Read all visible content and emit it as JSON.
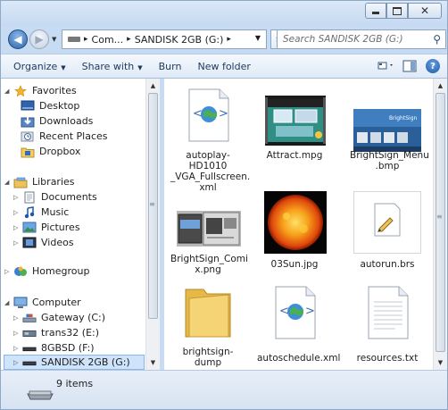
{
  "window": {
    "caption_buttons": [
      "minimize",
      "maximize",
      "close"
    ]
  },
  "address_bar": {
    "segments": [
      "Com...",
      "SANDISK 2GB (G:)"
    ],
    "separator": "▸",
    "search_placeholder": "Search SANDISK 2GB (G:)"
  },
  "toolbar": {
    "organize": "Organize",
    "share_with": "Share with",
    "burn": "Burn",
    "new_folder": "New folder",
    "view_icon": "view-options-icon",
    "preview_icon": "preview-pane-icon",
    "help_icon": "help-icon",
    "help_glyph": "?"
  },
  "nav_pane": {
    "favorites": {
      "label": "Favorites",
      "items": [
        "Desktop",
        "Downloads",
        "Recent Places",
        "Dropbox"
      ]
    },
    "libraries": {
      "label": "Libraries",
      "items": [
        "Documents",
        "Music",
        "Pictures",
        "Videos"
      ]
    },
    "homegroup": {
      "label": "Homegroup"
    },
    "computer": {
      "label": "Computer",
      "items": [
        "Gateway (C:)",
        "trans32 (E:)",
        "8GBSD (F:)",
        "SANDISK 2GB (G:)"
      ],
      "selected": "SANDISK 2GB (G:)"
    }
  },
  "files": [
    {
      "name": "autoplay-HD1010_VGA_Fullscreen.xml",
      "lines": [
        "autoplay-HD1010",
        "_VGA_Fullscreen.",
        "xml"
      ],
      "type": "xml"
    },
    {
      "name": "Attract.mpg",
      "lines": [
        "Attract.mpg"
      ],
      "type": "video"
    },
    {
      "name": "BrightSign_Menu.bmp",
      "lines": [
        "BrightSign_Menu",
        ".bmp"
      ],
      "type": "bmp"
    },
    {
      "name": "BrightSign_Comix.png",
      "lines": [
        "BrightSign_Comi",
        "x.png"
      ],
      "type": "png"
    },
    {
      "name": "03Sun.jpg",
      "lines": [
        "03Sun.jpg"
      ],
      "type": "sun"
    },
    {
      "name": "autorun.brs",
      "lines": [
        "autorun.brs"
      ],
      "type": "brs"
    },
    {
      "name": "brightsign-dumps",
      "lines": [
        "brightsign-dump",
        "s"
      ],
      "type": "folder"
    },
    {
      "name": "autoschedule.xml",
      "lines": [
        "autoschedule.xml"
      ],
      "type": "xml"
    },
    {
      "name": "resources.txt",
      "lines": [
        "resources.txt"
      ],
      "type": "txt"
    }
  ],
  "details_pane": {
    "count": "9 items"
  },
  "colors": {
    "chrome": "#c7dcf3",
    "selection": "#cfe4fb",
    "link_text": "#1e395b"
  }
}
